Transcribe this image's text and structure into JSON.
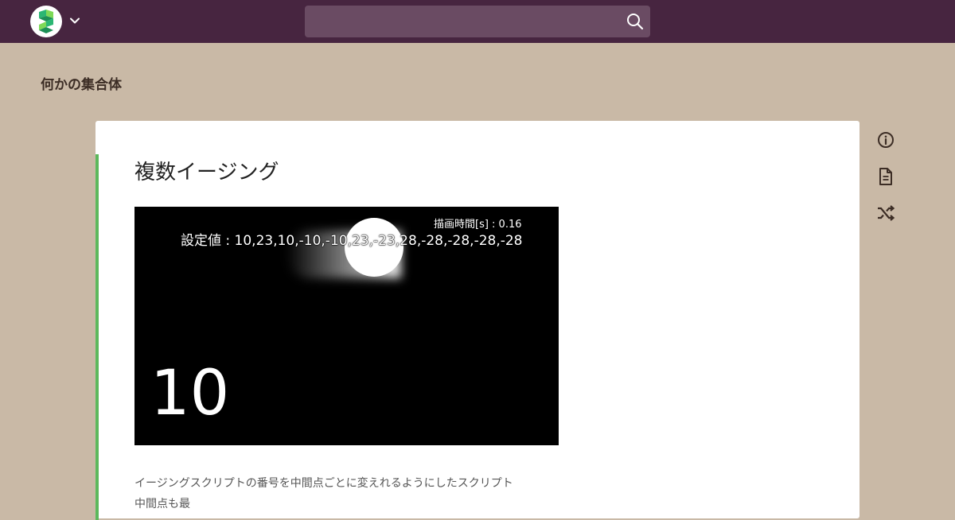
{
  "topbar": {
    "logo_alt": "Scrapbox",
    "search": {
      "value": "",
      "placeholder": ""
    }
  },
  "project": {
    "title": "何かの集合体"
  },
  "page": {
    "title": "複数イージング",
    "image": {
      "render_time_label": "描画時間[s] : 0.16",
      "setting_value_label": "設定値 : 10,23,10,-10,-10,23,-23,28,-28,-28,-28,-28",
      "big_number": "10"
    },
    "description_lines": [
      "イージングスクリプトの番号を中間点ごとに変えれるようにしたスクリプト",
      "中間点も最"
    ]
  },
  "side_tools": [
    {
      "icon": "info-icon"
    },
    {
      "icon": "document-icon"
    },
    {
      "icon": "shuffle-icon"
    }
  ],
  "colors": {
    "topbar": "#472540",
    "background": "#c9b9a6",
    "search_bg": "#6a4b63",
    "line_marker": "#5cb85c"
  }
}
